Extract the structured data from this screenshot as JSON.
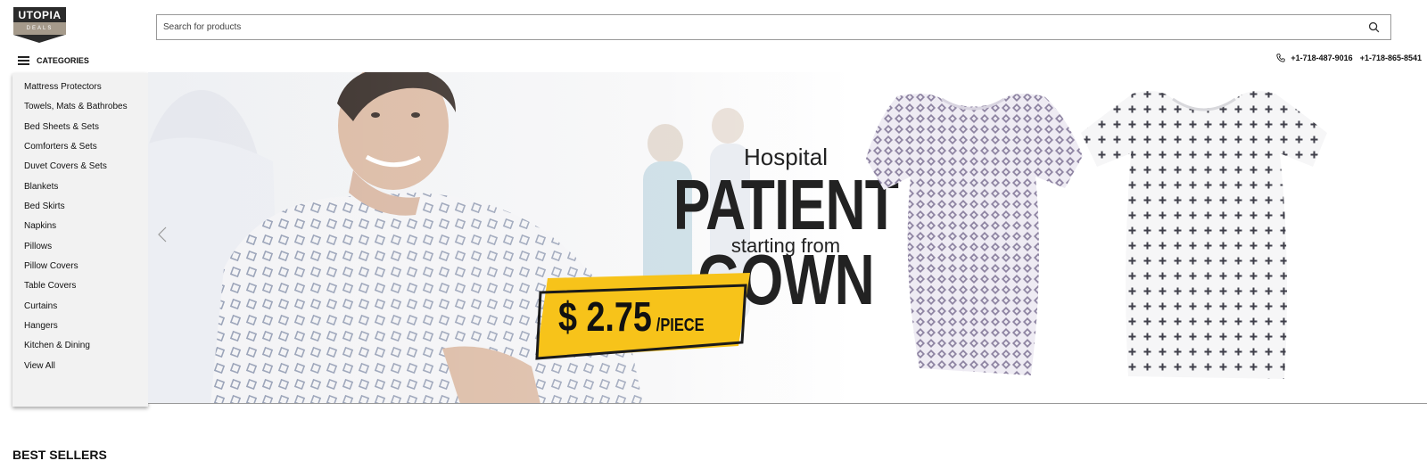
{
  "logo": {
    "line1": "UTOPIA",
    "line2": "DEALS"
  },
  "search": {
    "placeholder": "Search for products",
    "icon": "search-icon"
  },
  "categories": {
    "label": "CATEGORIES",
    "items": [
      "Mattress Protectors",
      "Towels, Mats & Bathrobes",
      "Bed Sheets & Sets",
      "Comforters & Sets",
      "Duvet Covers & Sets",
      "Blankets",
      "Bed Skirts",
      "Napkins",
      "Pillows",
      "Pillow Covers",
      "Table Covers",
      "Curtains",
      "Hangers",
      "Kitchen & Dining",
      "View All"
    ]
  },
  "contact": {
    "phone1": "+1-718-487-9016",
    "phone2": "+1-718-865-8541",
    "icon": "phone-icon"
  },
  "banner": {
    "line1": "Hospital",
    "headline": "PATIENT GOWN",
    "line3": "starting from",
    "price": "$ 2.75",
    "unit": "/PIECE",
    "accent_color": "#f7c31a"
  },
  "sections": {
    "best_sellers": "BEST SELLERS"
  }
}
